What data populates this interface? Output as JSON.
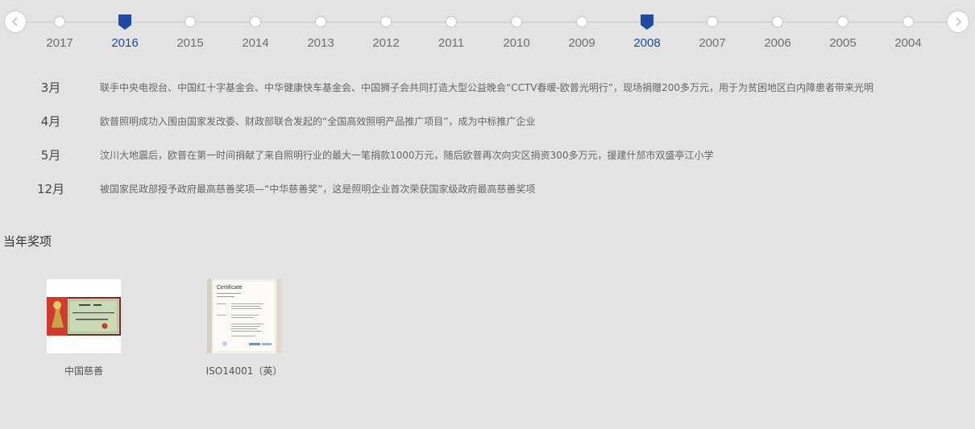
{
  "timeline": {
    "prev_icon": "chevron-left-icon",
    "next_icon": "chevron-right-icon",
    "years": [
      {
        "label": "2017",
        "active": false
      },
      {
        "label": "2016",
        "active": true
      },
      {
        "label": "2015",
        "active": false
      },
      {
        "label": "2014",
        "active": false
      },
      {
        "label": "2013",
        "active": false
      },
      {
        "label": "2012",
        "active": false
      },
      {
        "label": "2011",
        "active": false
      },
      {
        "label": "2010",
        "active": false
      },
      {
        "label": "2009",
        "active": false
      },
      {
        "label": "2008",
        "active": true
      },
      {
        "label": "2007",
        "active": false
      },
      {
        "label": "2006",
        "active": false
      },
      {
        "label": "2005",
        "active": false
      },
      {
        "label": "2004",
        "active": false
      }
    ],
    "active_color": "#1e4aa0"
  },
  "events": [
    {
      "month": "3月",
      "text": "联手中央电视台、中国红十字基金会、中华健康快车基金会、中国狮子会共同打造大型公益晚会“CCTV春暖-欧普光明行”，现场捐赠200多万元，用于为贫困地区白内障患者带来光明"
    },
    {
      "month": "4月",
      "text": "欧普照明成功入围由国家发改委、财政部联合发起的“全国高效照明产品推广项目”，成为中标推广企业"
    },
    {
      "month": "5月",
      "text": "汶川大地震后，欧普在第一时间捐献了来自照明行业的最大一笔捐款1000万元，随后欧普再次向灾区捐资300多万元，援建什邡市双盛亭江小学"
    },
    {
      "month": "12月",
      "text": "被国家民政部授予政府最高慈善奖项—“中华慈善奖”，这是照明企业首次荣获国家级政府最高慈善奖项"
    }
  ],
  "awards": {
    "title": "当年奖项",
    "items": [
      {
        "caption": "中国慈善",
        "icon": "award-certificate-image"
      },
      {
        "caption": "ISO14001（英）",
        "icon": "iso-certificate-image",
        "image_heading": "Certificate"
      }
    ]
  }
}
